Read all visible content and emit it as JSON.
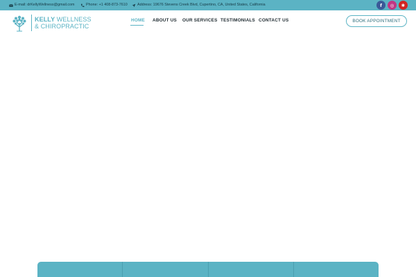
{
  "topbar": {
    "email": "E-mail: drKellyWellness@gmail.com",
    "phone": "Phone: +1 408-873-7610",
    "address": "Address: 19676 Stevens Creek Blvd, Cupertino, CA, United States, California",
    "social": [
      {
        "name": "facebook",
        "glyph": "f"
      },
      {
        "name": "instagram",
        "glyph": "◎"
      },
      {
        "name": "yelp",
        "glyph": "✱"
      }
    ]
  },
  "logo": {
    "brand": "KELLY",
    "line1_rest": " WELLNESS",
    "line2": "& CHIROPRACTIC"
  },
  "nav": {
    "items": [
      "HOME",
      "ABOUT US",
      "OUR SERVICES",
      "TESTIMONIALS",
      "CONTACT US"
    ],
    "active": "HOME"
  },
  "cta": {
    "book_label": "BOOK APPOINTMENT"
  },
  "colors": {
    "accent": "#5bb3c4",
    "dark_text": "#1e2a30"
  }
}
